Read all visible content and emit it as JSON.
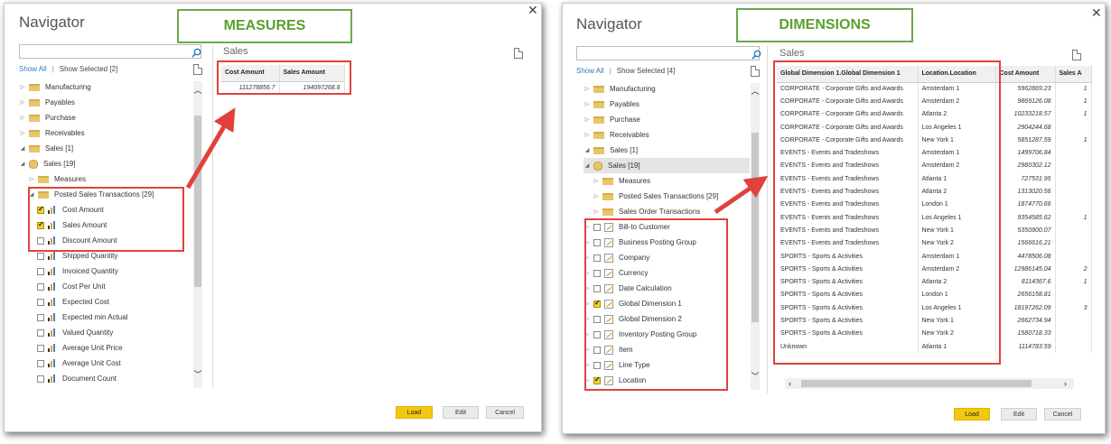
{
  "measures_panel": {
    "title": "Navigator",
    "close_icon": "close-icon",
    "links": {
      "show_all": "Show All",
      "show_selected": "Show Selected [2]"
    },
    "tree": [
      {
        "label": "Manufacturing",
        "kind": "folder",
        "expander": "▷"
      },
      {
        "label": "Payables",
        "kind": "folder",
        "expander": "▷"
      },
      {
        "label": "Purchase",
        "kind": "folder",
        "expander": "▷"
      },
      {
        "label": "Receivables",
        "kind": "folder",
        "expander": "▷"
      },
      {
        "label": "Sales [1]",
        "kind": "folder",
        "expander": "◢"
      },
      {
        "label": "Sales [19]",
        "kind": "db",
        "expander": "◢"
      },
      {
        "label": "Measures",
        "kind": "folder",
        "expander": "▷"
      },
      {
        "label": "Posted Sales Transactions [29]",
        "kind": "folder",
        "expander": "◢"
      },
      {
        "label": "Cost Amount",
        "kind": "measure",
        "checked": true
      },
      {
        "label": "Sales Amount",
        "kind": "measure",
        "checked": true
      },
      {
        "label": "Discount Amount",
        "kind": "measure",
        "checked": false
      },
      {
        "label": "Shipped Quantity",
        "kind": "measure",
        "checked": false
      },
      {
        "label": "Invoiced Quantity",
        "kind": "measure",
        "checked": false
      },
      {
        "label": "Cost Per Unit",
        "kind": "measure",
        "checked": false
      },
      {
        "label": "Expected Cost",
        "kind": "measure",
        "checked": false
      },
      {
        "label": "Expected min Actual",
        "kind": "measure",
        "checked": false
      },
      {
        "label": "Valued Quantity",
        "kind": "measure",
        "checked": false
      },
      {
        "label": "Average Unit Price",
        "kind": "measure",
        "checked": false
      },
      {
        "label": "Average Unit Cost",
        "kind": "measure",
        "checked": false
      },
      {
        "label": "Document Count",
        "kind": "measure",
        "checked": false
      }
    ],
    "preview_title": "Sales",
    "preview_columns": [
      "Cost Amount",
      "Sales Amount"
    ],
    "preview_rows": [
      [
        "111278856.7",
        "194097268.8"
      ]
    ],
    "buttons": {
      "load": "Load",
      "edit": "Edit",
      "cancel": "Cancel"
    },
    "callout": "MEASURES"
  },
  "dimensions_panel": {
    "title": "Navigator",
    "close_icon": "close-icon",
    "links": {
      "show_all": "Show All",
      "show_selected": "Show Selected [4]"
    },
    "tree": [
      {
        "label": "Manufacturing",
        "kind": "folder",
        "expander": "▷"
      },
      {
        "label": "Payables",
        "kind": "folder",
        "expander": "▷"
      },
      {
        "label": "Purchase",
        "kind": "folder",
        "expander": "▷"
      },
      {
        "label": "Receivables",
        "kind": "folder",
        "expander": "▷"
      },
      {
        "label": "Sales [1]",
        "kind": "folder",
        "expander": "◢"
      },
      {
        "label": "Sales [19]",
        "kind": "db",
        "expander": "◢"
      },
      {
        "label": "Measures",
        "kind": "folder",
        "expander": "▷"
      },
      {
        "label": "Posted Sales Transactions [29]",
        "kind": "folder",
        "expander": "▷"
      },
      {
        "label": "Sales Order Transactions",
        "kind": "folder",
        "expander": "▷"
      },
      {
        "label": "Bill-to Customer",
        "kind": "dimension",
        "checked": false
      },
      {
        "label": "Business Posting Group",
        "kind": "dimension",
        "checked": false
      },
      {
        "label": "Company",
        "kind": "dimension",
        "checked": false
      },
      {
        "label": "Currency",
        "kind": "dimension",
        "checked": false
      },
      {
        "label": "Date Calculation",
        "kind": "dimension",
        "checked": false
      },
      {
        "label": "Global Dimension 1",
        "kind": "dimension",
        "checked": true
      },
      {
        "label": "Global Dimension 2",
        "kind": "dimension",
        "checked": false
      },
      {
        "label": "Inventory Posting Group",
        "kind": "dimension",
        "checked": false
      },
      {
        "label": "Item",
        "kind": "dimension",
        "checked": false
      },
      {
        "label": "Line Type",
        "kind": "dimension",
        "checked": false
      },
      {
        "label": "Location",
        "kind": "dimension",
        "checked": true
      }
    ],
    "preview_title": "Sales",
    "preview_columns": [
      "Global Dimension 1.Global Dimension 1",
      "Location.Location",
      "Cost Amount",
      "Sales A"
    ],
    "preview_rows": [
      [
        "CORPORATE - Corporate Gifts and Awards",
        "Amsterdam 1",
        "5962869.23",
        "1"
      ],
      [
        "CORPORATE - Corporate Gifts and Awards",
        "Amsterdam 2",
        "9869126.08",
        "1"
      ],
      [
        "CORPORATE - Corporate Gifts and Awards",
        "Atlanta 2",
        "10233218.57",
        "1"
      ],
      [
        "CORPORATE - Corporate Gifts and Awards",
        "Los Angeles 1",
        "2904244.68",
        ""
      ],
      [
        "CORPORATE - Corporate Gifts and Awards",
        "New York 1",
        "5851287.59",
        "1"
      ],
      [
        "EVENTS - Events and Tradeshows",
        "Amsterdam 1",
        "1499706.84",
        ""
      ],
      [
        "EVENTS - Events and Tradeshows",
        "Amsterdam 2",
        "2980302.12",
        ""
      ],
      [
        "EVENTS - Events and Tradeshows",
        "Atlanta 1",
        "727531.95",
        ""
      ],
      [
        "EVENTS - Events and Tradeshows",
        "Atlanta 2",
        "1313020.56",
        ""
      ],
      [
        "EVENTS - Events and Tradeshows",
        "London 1",
        "1874770.66",
        ""
      ],
      [
        "EVENTS - Events and Tradeshows",
        "Los Angeles 1",
        "9354585.62",
        "1"
      ],
      [
        "EVENTS - Events and Tradeshows",
        "New York 1",
        "5350900.07",
        ""
      ],
      [
        "EVENTS - Events and Tradeshows",
        "New York 2",
        "1566616.21",
        ""
      ],
      [
        "SPORTS - Sports & Activities",
        "Amsterdam 1",
        "4478506.08",
        ""
      ],
      [
        "SPORTS - Sports & Activities",
        "Amsterdam 2",
        "12986145.04",
        "2"
      ],
      [
        "SPORTS - Sports & Activities",
        "Atlanta 2",
        "8114367.6",
        "1"
      ],
      [
        "SPORTS - Sports & Activities",
        "London 1",
        "2656158.81",
        ""
      ],
      [
        "SPORTS - Sports & Activities",
        "Los Angeles 1",
        "18197262.09",
        "3"
      ],
      [
        "SPORTS - Sports & Activities",
        "New York 1",
        "2662734.94",
        ""
      ],
      [
        "SPORTS - Sports & Activities",
        "New York 2",
        "1580718.33",
        ""
      ],
      [
        "Unknown",
        "Atlanta 1",
        "1114783.59",
        ""
      ]
    ],
    "buttons": {
      "load": "Load",
      "edit": "Edit",
      "cancel": "Cancel"
    },
    "callout": "DIMENSIONS"
  },
  "colors": {
    "accent_load": "#f2c811",
    "callout_border": "#6aa84f",
    "callout_text": "#5aa02c",
    "annotation_red": "#e0423b",
    "link_blue": "#2e7cc1"
  }
}
